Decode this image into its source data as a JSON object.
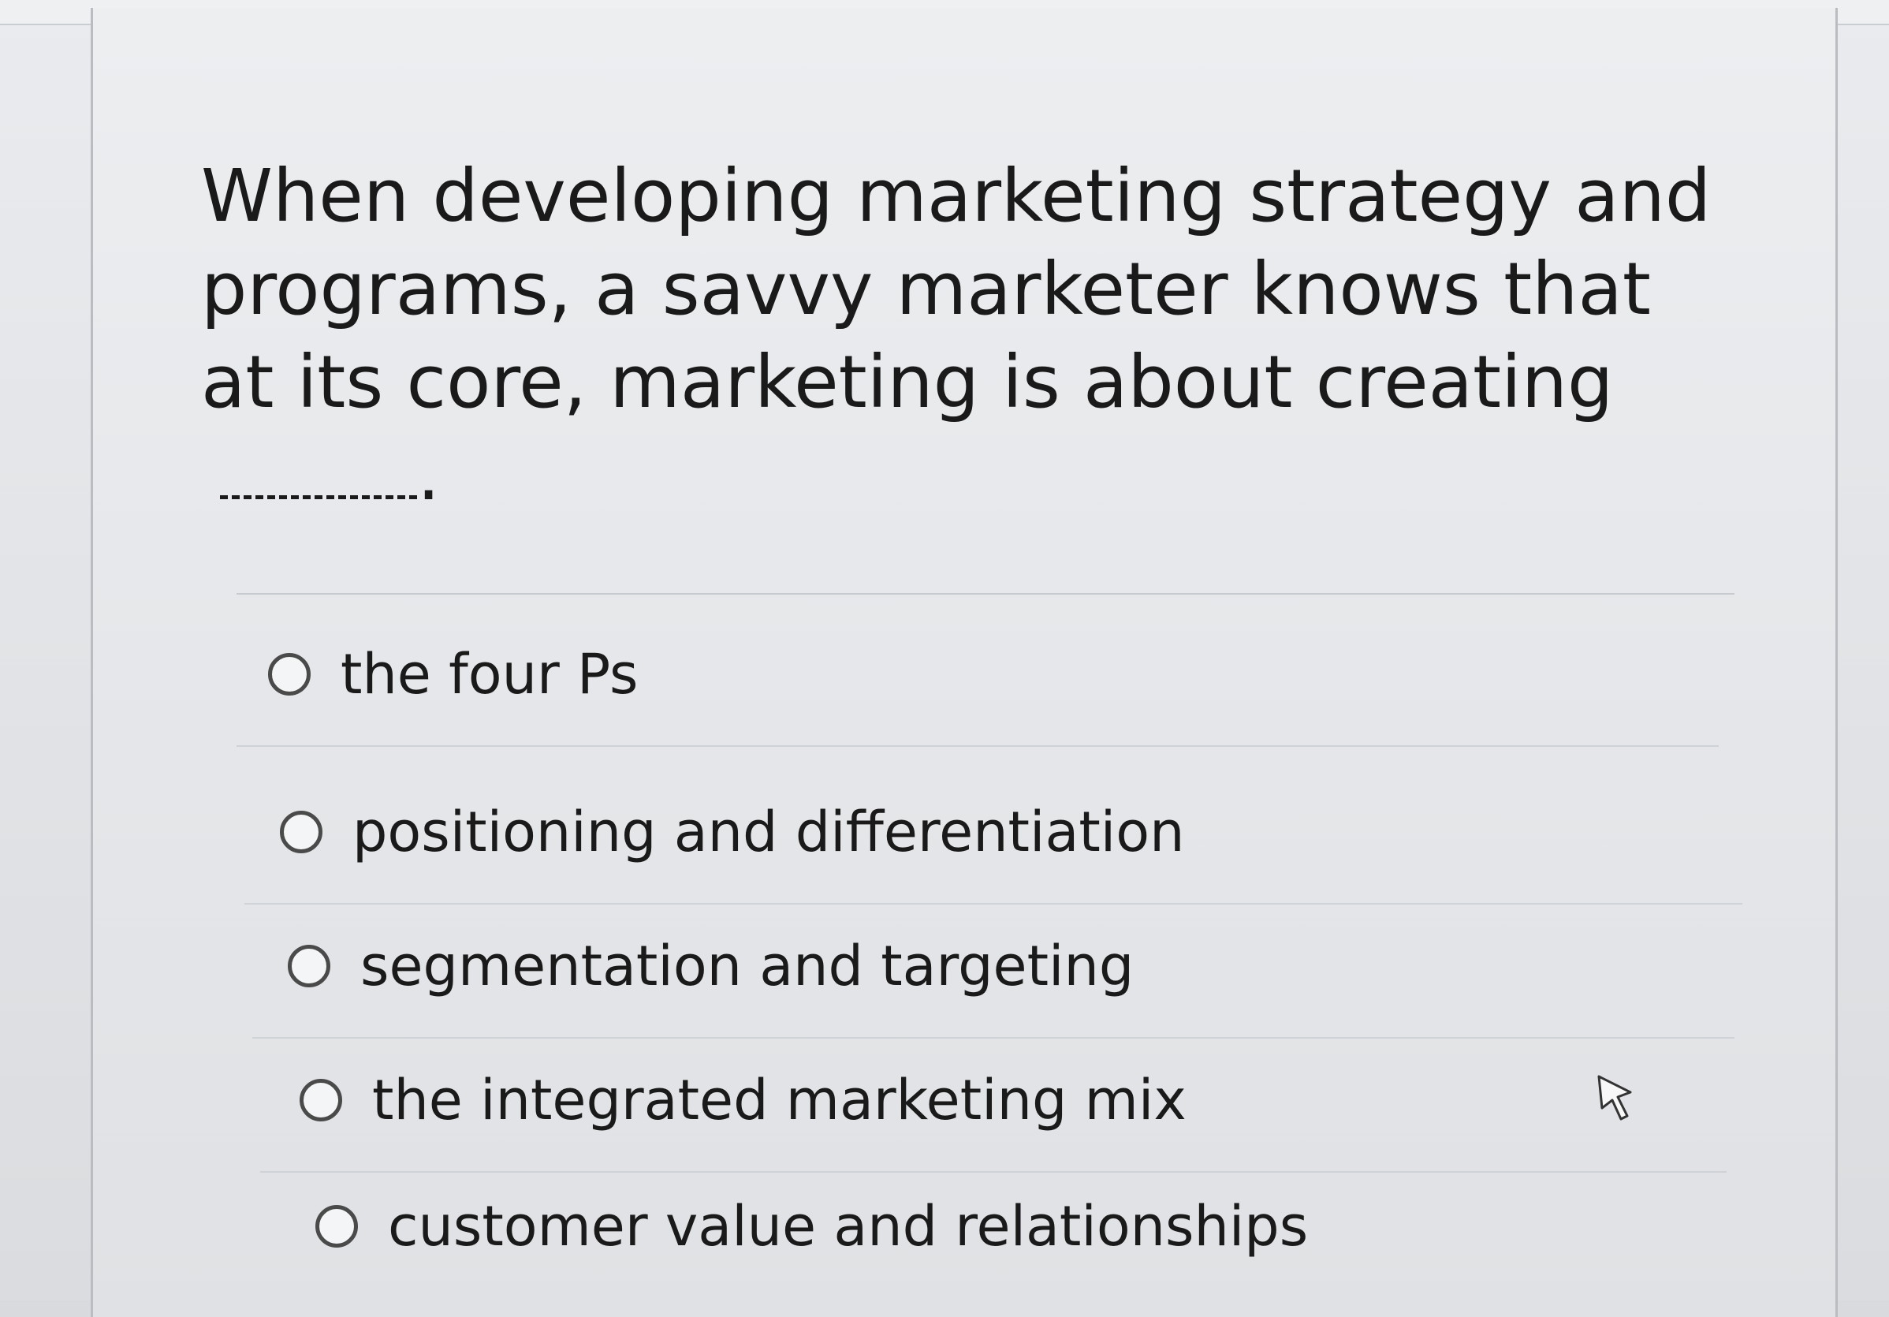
{
  "question": {
    "text": "When developing marketing strategy and programs, a savvy marketer knows that at its core, marketing is about creating",
    "end_punctuation": "."
  },
  "options": [
    {
      "label": "the four Ps"
    },
    {
      "label": "positioning and differentiation"
    },
    {
      "label": "segmentation and targeting"
    },
    {
      "label": "the integrated marketing mix"
    },
    {
      "label": "customer value and relationships"
    }
  ],
  "colors": {
    "background": "#e5e7ea",
    "text": "#1a1a1a",
    "radio_border": "#4a4a4a"
  },
  "icons": {
    "cursor": "hand-pointer-icon"
  }
}
